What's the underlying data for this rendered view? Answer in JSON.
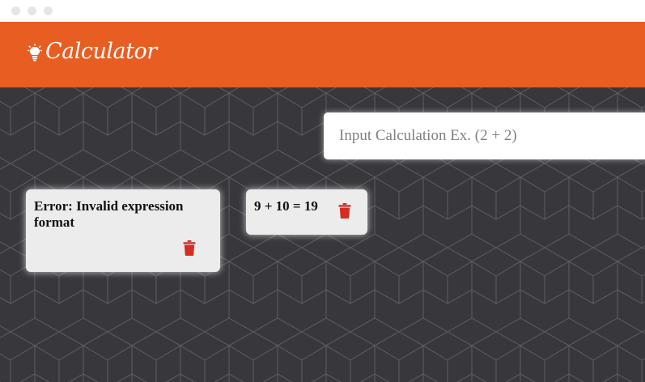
{
  "window": {
    "controls": [
      "close",
      "minimize",
      "maximize"
    ]
  },
  "header": {
    "icon": "lightbulb-icon",
    "title": "Calculator",
    "background_color": "#e85d22"
  },
  "calculator": {
    "input_placeholder": "Input Calculation Ex. (2 + 2)",
    "input_value": ""
  },
  "results": [
    {
      "text": "Error: Invalid expression format",
      "delete_icon": "trash-icon"
    },
    {
      "text": "9 + 10 = 19",
      "delete_icon": "trash-icon"
    }
  ],
  "theme": {
    "background": "#38373b",
    "card_background": "#ececec",
    "delete_icon_color": "#d32d26"
  }
}
